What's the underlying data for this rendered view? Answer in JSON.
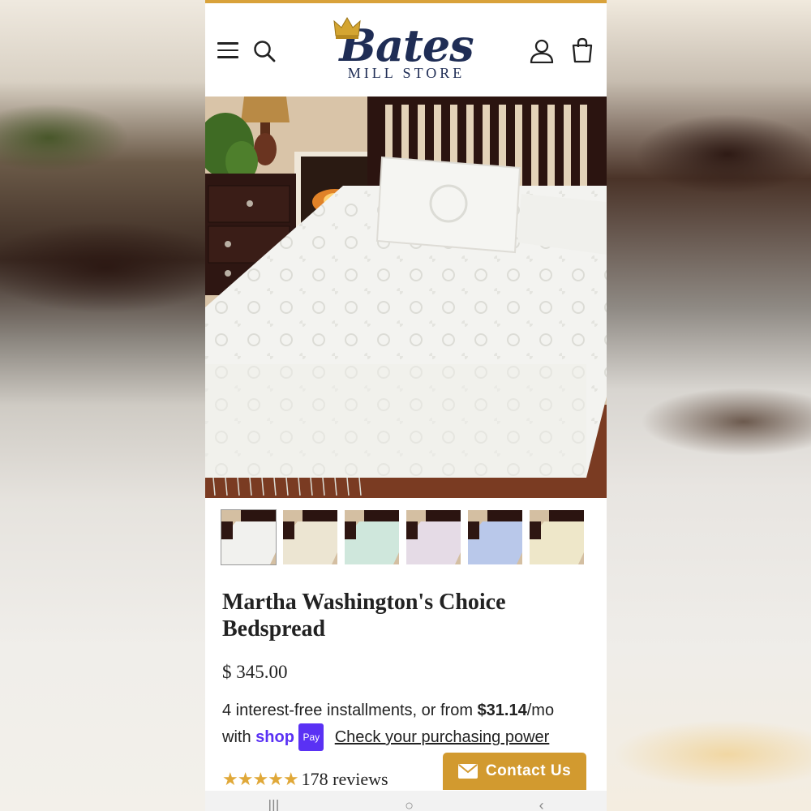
{
  "header": {
    "menu_icon": "hamburger-menu-icon",
    "search_icon": "search-icon",
    "logo_script": "Bates",
    "logo_sub": "MILL STORE",
    "account_icon": "user-icon",
    "cart_icon": "shopping-bag-icon",
    "accent_color": "#d9a23a",
    "brand_color": "#1f2d55"
  },
  "gallery": {
    "thumbnails": [
      {
        "color": "white",
        "tint": "#f1f1ee"
      },
      {
        "color": "cream",
        "tint": "#ece5d2"
      },
      {
        "color": "mint",
        "tint": "#cfe7dc"
      },
      {
        "color": "lilac",
        "tint": "#e5dbe6"
      },
      {
        "color": "blue",
        "tint": "#b9c8ea"
      },
      {
        "color": "ivory",
        "tint": "#eee7c9"
      }
    ]
  },
  "product": {
    "title": "Martha Washington's Choice Bedspread",
    "price": "$ 345.00",
    "installments_text": "4 interest-free installments, or from",
    "installment_amount": "$31.14",
    "installment_period": "/mo",
    "with_text": "with",
    "shop_text": "shop",
    "pay_text": "Pay",
    "check_link": "Check your purchasing power",
    "stars": "★★★★★",
    "rating": 5,
    "reviews_text": "178 reviews"
  },
  "contact": {
    "label": "Contact Us",
    "icon": "envelope-icon",
    "color": "#d29a2f"
  }
}
